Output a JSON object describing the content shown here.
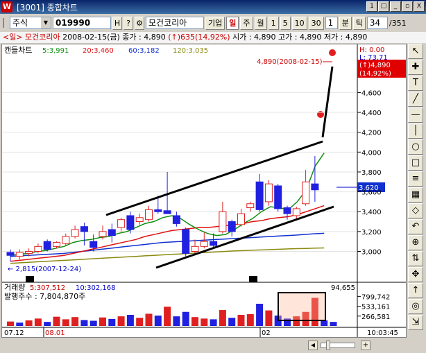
{
  "window": {
    "title": "[3001] 종합차트"
  },
  "title_buttons": [
    "1",
    "□",
    "_",
    "▫",
    "X"
  ],
  "toolbar": {
    "market": "주식",
    "code": "019990",
    "btn_h": "H",
    "btn_q": "?",
    "btn_search": "⚙",
    "name": "모건코리아",
    "btn_corp": "기업",
    "periods": [
      "일",
      "주",
      "월"
    ],
    "active_period": "일",
    "counts": [
      "1",
      "5",
      "10",
      "30"
    ],
    "count_value": "1",
    "minute": "분",
    "tick": "틱",
    "display_count": "34",
    "total": "/351"
  },
  "info": {
    "period_name": "<일> 모건코리아",
    "date": "2008-02-15(금)",
    "close_label": "종가 : 4,890",
    "change": "(↑)635(14,92%)",
    "open": "시가 : 4,890",
    "high": "고가 : 4,890",
    "low": "저가 : 4,890"
  },
  "chart_legend": {
    "label": "캔들차트",
    "ma5": "5:3,991",
    "ma20": "20:3,460",
    "ma60": "60:3,182",
    "ma120": "120:3,035"
  },
  "hl_box": {
    "h": "H: 0.00",
    "l": "L: 73.71"
  },
  "price_flag": {
    "line1": "(↑)4,890",
    "line2": "(14,92%)"
  },
  "annot_max": "4,890(2008-02-15)",
  "annot_min": "← 2,815(2007-12-24)",
  "cursor_price": "3,620",
  "volume_legend": {
    "label": "거래량",
    "v5": "5:307,512",
    "v10": "10:302,168",
    "shares": "발행주수 : 7,804,870주",
    "max": "94,655"
  },
  "x_labels": [
    "07.12",
    "08.01",
    "02"
  ],
  "time": "10:03:45",
  "colors": {
    "up": "#e02020",
    "down": "#2020e0",
    "ma5": "#109010",
    "ma20": "#e01010",
    "ma60": "#1030d0",
    "ma120": "#8a8a10"
  },
  "chart_data": {
    "type": "candlestick",
    "y_ticks": [
      3000,
      3200,
      3400,
      3600,
      3800,
      4000,
      4200,
      4400,
      4600
    ],
    "y_tick_labels": [
      "3,000",
      "3,200",
      "3,400",
      "3,600",
      "3,800",
      "4,000",
      "4,200",
      "4,400",
      "4,600"
    ],
    "vol_ticks_labels": [
      "799,742",
      "533,161",
      "266,581"
    ],
    "vol_ticks": [
      799742,
      533161,
      266581
    ],
    "ylim": [
      2780,
      4980
    ],
    "candles": [
      {
        "o": 2990,
        "c": 2960,
        "h": 3020,
        "l": 2900
      },
      {
        "o": 2950,
        "c": 2990,
        "h": 3020,
        "l": 2920
      },
      {
        "o": 2980,
        "c": 3000,
        "h": 3030,
        "l": 2950
      },
      {
        "o": 3000,
        "c": 3050,
        "h": 3080,
        "l": 2980
      },
      {
        "o": 3100,
        "c": 3020,
        "h": 3120,
        "l": 3000
      },
      {
        "o": 3050,
        "c": 3090,
        "h": 3100,
        "l": 3030
      },
      {
        "o": 3080,
        "c": 3150,
        "h": 3180,
        "l": 3060
      },
      {
        "o": 3150,
        "c": 3220,
        "h": 3260,
        "l": 3130
      },
      {
        "o": 3250,
        "c": 3200,
        "h": 3290,
        "l": 3060
      },
      {
        "o": 3100,
        "c": 3040,
        "h": 3170,
        "l": 3000
      },
      {
        "o": 3150,
        "c": 3200,
        "h": 3260,
        "l": 3120
      },
      {
        "o": 3220,
        "c": 3160,
        "h": 3280,
        "l": 3090
      },
      {
        "o": 3240,
        "c": 3320,
        "h": 3340,
        "l": 3200
      },
      {
        "o": 3360,
        "c": 3220,
        "h": 3400,
        "l": 3180
      },
      {
        "o": 3300,
        "c": 3340,
        "h": 3380,
        "l": 3270
      },
      {
        "o": 3320,
        "c": 3420,
        "h": 3460,
        "l": 3300
      },
      {
        "o": 3420,
        "c": 3400,
        "h": 3560,
        "l": 3380
      },
      {
        "o": 3410,
        "c": 3380,
        "h": 3800,
        "l": 3380
      },
      {
        "o": 3360,
        "c": 3280,
        "h": 3400,
        "l": 3250
      },
      {
        "o": 3220,
        "c": 2980,
        "h": 3240,
        "l": 2950
      },
      {
        "o": 3000,
        "c": 3050,
        "h": 3120,
        "l": 2980
      },
      {
        "o": 3050,
        "c": 3100,
        "h": 3190,
        "l": 3030
      },
      {
        "o": 3100,
        "c": 3060,
        "h": 3180,
        "l": 3040
      },
      {
        "o": 3200,
        "c": 3400,
        "h": 3500,
        "l": 3180
      },
      {
        "o": 3300,
        "c": 3200,
        "h": 3320,
        "l": 3150
      },
      {
        "o": 3270,
        "c": 3380,
        "h": 3430,
        "l": 3250
      },
      {
        "o": 3440,
        "c": 3480,
        "h": 3500,
        "l": 3400
      },
      {
        "o": 3700,
        "c": 3420,
        "h": 3780,
        "l": 3400
      },
      {
        "o": 3500,
        "c": 3680,
        "h": 3720,
        "l": 3460
      },
      {
        "o": 3660,
        "c": 3430,
        "h": 3680,
        "l": 3400
      },
      {
        "o": 3440,
        "c": 3380,
        "h": 3460,
        "l": 3320
      },
      {
        "o": 3360,
        "c": 3430,
        "h": 3450,
        "l": 3330
      },
      {
        "o": 3480,
        "c": 3700,
        "h": 3820,
        "l": 3460
      },
      {
        "o": 3680,
        "c": 3620,
        "h": 3960,
        "l": 3500
      }
    ],
    "ma5": [
      2960,
      2970,
      2980,
      3000,
      3010,
      3030,
      3050,
      3090,
      3110,
      3120,
      3140,
      3150,
      3180,
      3200,
      3240,
      3280,
      3300,
      3340,
      3360,
      3330,
      3270,
      3220,
      3180,
      3160,
      3170,
      3220,
      3280,
      3330,
      3400,
      3450,
      3440,
      3420,
      3500,
      3620,
      3860,
      3991
    ],
    "ma20": [
      2900,
      2910,
      2920,
      2930,
      2940,
      2950,
      2960,
      2980,
      3000,
      3020,
      3040,
      3060,
      3080,
      3100,
      3120,
      3150,
      3170,
      3190,
      3210,
      3220,
      3230,
      3240,
      3240,
      3250,
      3260,
      3270,
      3280,
      3300,
      3310,
      3330,
      3340,
      3350,
      3370,
      3400,
      3430,
      3460
    ],
    "ma60": [
      2950,
      2955,
      2960,
      2965,
      2970,
      2975,
      2980,
      2990,
      3000,
      3010,
      3020,
      3030,
      3040,
      3050,
      3060,
      3070,
      3080,
      3090,
      3095,
      3100,
      3105,
      3110,
      3115,
      3120,
      3125,
      3130,
      3135,
      3140,
      3145,
      3150,
      3155,
      3160,
      3165,
      3172,
      3178,
      3182
    ],
    "ma120": [
      2880,
      2885,
      2890,
      2895,
      2900,
      2905,
      2910,
      2915,
      2920,
      2925,
      2930,
      2935,
      2940,
      2945,
      2950,
      2955,
      2960,
      2965,
      2970,
      2975,
      2980,
      2985,
      2990,
      2995,
      3000,
      3005,
      3008,
      3012,
      3015,
      3018,
      3022,
      3025,
      3028,
      3030,
      3033,
      3035
    ],
    "volume": [
      {
        "v": 120000,
        "up": true
      },
      {
        "v": 90000,
        "up": false
      },
      {
        "v": 150000,
        "up": true
      },
      {
        "v": 200000,
        "up": true
      },
      {
        "v": 110000,
        "up": false
      },
      {
        "v": 250000,
        "up": true
      },
      {
        "v": 180000,
        "up": true
      },
      {
        "v": 240000,
        "up": true
      },
      {
        "v": 160000,
        "up": false
      },
      {
        "v": 140000,
        "up": false
      },
      {
        "v": 230000,
        "up": true
      },
      {
        "v": 190000,
        "up": false
      },
      {
        "v": 260000,
        "up": true
      },
      {
        "v": 300000,
        "up": false
      },
      {
        "v": 220000,
        "up": true
      },
      {
        "v": 330000,
        "up": true
      },
      {
        "v": 280000,
        "up": false
      },
      {
        "v": 520000,
        "up": true
      },
      {
        "v": 260000,
        "up": false
      },
      {
        "v": 380000,
        "up": false
      },
      {
        "v": 240000,
        "up": true
      },
      {
        "v": 200000,
        "up": true
      },
      {
        "v": 180000,
        "up": false
      },
      {
        "v": 430000,
        "up": true
      },
      {
        "v": 220000,
        "up": false
      },
      {
        "v": 300000,
        "up": true
      },
      {
        "v": 320000,
        "up": true
      },
      {
        "v": 600000,
        "up": false
      },
      {
        "v": 420000,
        "up": true
      },
      {
        "v": 280000,
        "up": false
      },
      {
        "v": 200000,
        "up": false
      },
      {
        "v": 260000,
        "up": true
      },
      {
        "v": 380000,
        "up": true
      },
      {
        "v": 760000,
        "up": true
      },
      {
        "v": 150000,
        "up": false
      },
      {
        "v": 110000,
        "up": false
      }
    ]
  }
}
